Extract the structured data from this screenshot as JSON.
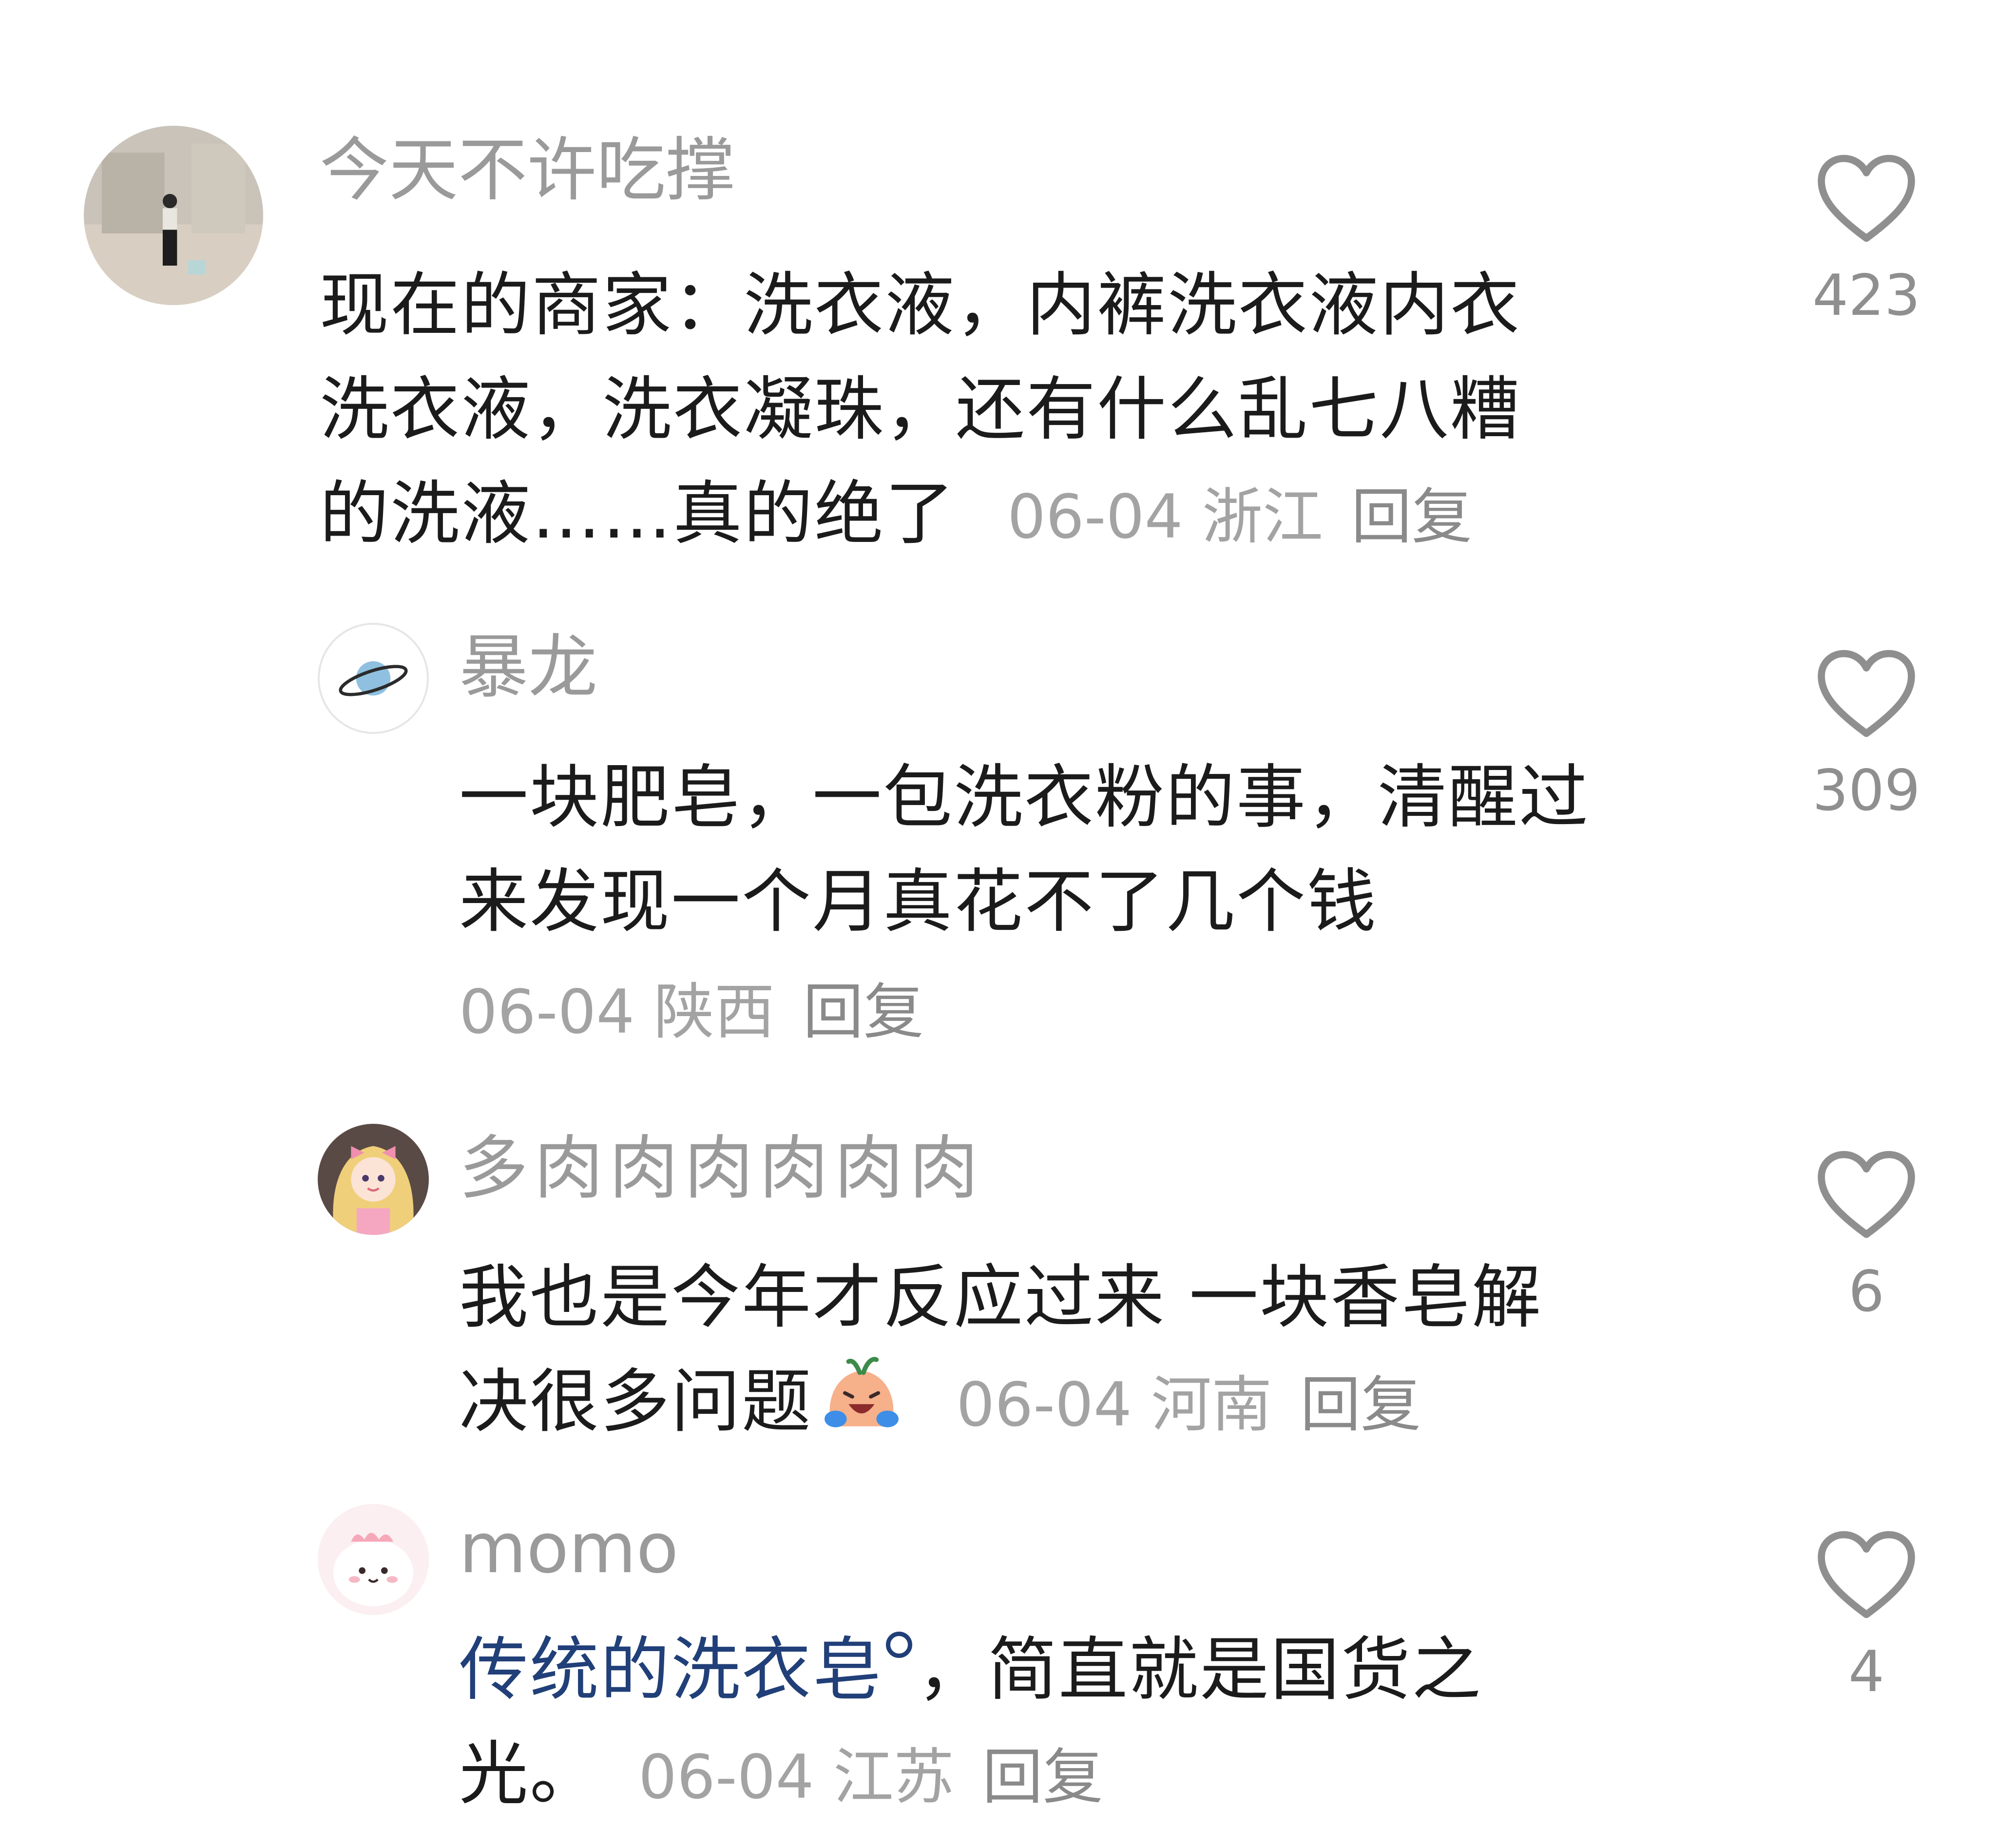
{
  "comments": [
    {
      "username": "今天不许吃撑",
      "lines": [
        "现在的商家：洗衣液，内裤洗衣液内衣",
        "洗衣液，洗衣凝珠，还有什么乱七八糟",
        "的洗液……真的绝了"
      ],
      "date": "06-04",
      "location": "浙江",
      "reply": "回复",
      "likes": "423",
      "avatar_icon": "photo-avatar-icon"
    },
    {
      "username": "暴龙",
      "lines": [
        "一块肥皂，一包洗衣粉的事，清醒过",
        "来发现一个月真花不了几个钱"
      ],
      "date": "06-04",
      "location": "陕西",
      "reply": "回复",
      "likes": "309",
      "avatar_icon": "planet-icon"
    },
    {
      "username": "多肉肉肉肉肉肉",
      "lines": [
        "我也是今年才反应过来 一块香皂解",
        "决很多问题"
      ],
      "date": "06-04",
      "location": "河南",
      "reply": "回复",
      "likes": "6",
      "avatar_icon": "cartoon-girl-avatar-icon",
      "emoji": "laugh-cry-emoji-icon"
    },
    {
      "username": "momo",
      "link_text": "传统的洗衣皂",
      "line1_rest": "，简直就是国货之",
      "line2": "光。",
      "date": "06-04",
      "location": "江苏",
      "reply": "回复",
      "likes": "4",
      "avatar_icon": "cute-character-avatar-icon"
    }
  ],
  "colors": {
    "username": "#9a9a9a",
    "body_text": "#1b1b1b",
    "meta": "#a3a3a3",
    "link": "#213f78",
    "like_icon": "#8f8f8f"
  }
}
